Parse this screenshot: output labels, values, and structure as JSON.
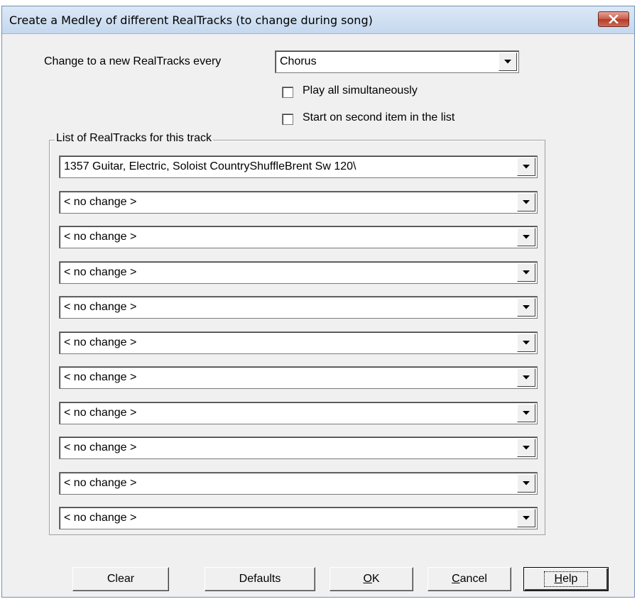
{
  "window": {
    "title": "Create a Medley of different RealTracks (to change during song)"
  },
  "change_every": {
    "label": "Change to a new RealTracks every",
    "selected": "Chorus"
  },
  "options": {
    "play_all_label": "Play all simultaneously",
    "play_all_checked": false,
    "start_second_label": "Start on second item in the list",
    "start_second_checked": false
  },
  "list": {
    "title": "List of RealTracks for this track",
    "items": [
      "1357 Guitar, Electric, Soloist CountryShuffleBrent Sw 120\\",
      "< no change >",
      "< no change >",
      "< no change >",
      "< no change >",
      "< no change >",
      "< no change >",
      "< no change >",
      "< no change >",
      "< no change >",
      "< no change >"
    ]
  },
  "buttons": {
    "clear": "Clear",
    "defaults": "Defaults",
    "ok_mnemonic": "O",
    "ok_rest": "K",
    "cancel_mnemonic": "C",
    "cancel_rest": "ancel",
    "help_mnemonic": "H",
    "help_rest": "elp"
  },
  "icons": {
    "close": "close-icon",
    "dropdown": "chevron-down-icon"
  }
}
